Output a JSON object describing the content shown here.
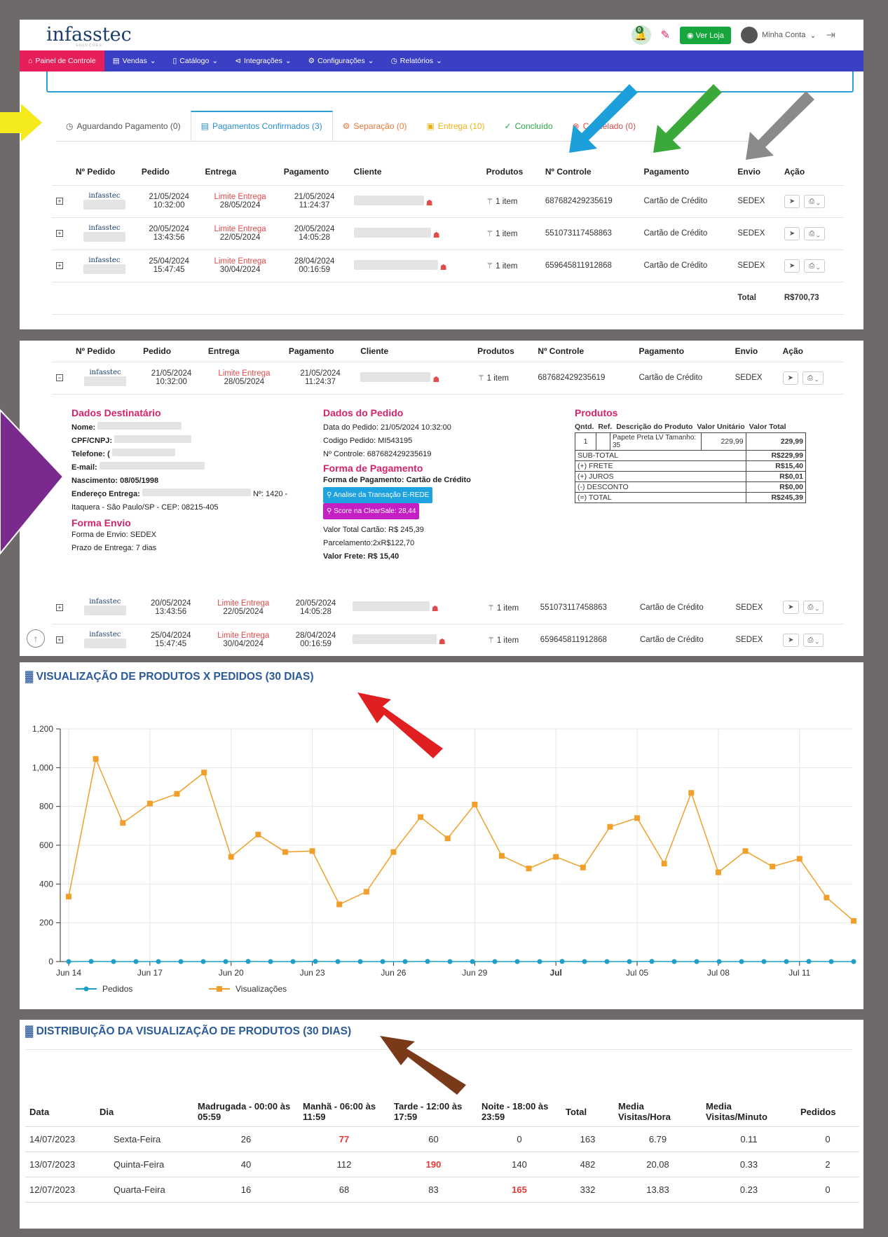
{
  "header": {
    "logo": "infasstec",
    "logo_tagline": "SOLUÇÕES",
    "notif_count": "0",
    "ver_loja": "Ver Loja",
    "minha_conta": "Minha Conta"
  },
  "nav": [
    "Painel de Controle",
    "Vendas",
    "Catálogo",
    "Integrações",
    "Configurações",
    "Relatórios"
  ],
  "tabs": [
    {
      "label": "Aguardando Pagamento (0)",
      "color": "#555"
    },
    {
      "label": "Pagamentos Confirmados (3)",
      "color": "#2a8fcc"
    },
    {
      "label": "Separação (0)",
      "color": "#e87a3a"
    },
    {
      "label": "Entrega (10)",
      "color": "#f0b21a"
    },
    {
      "label": "Concluído",
      "color": "#2aa84a"
    },
    {
      "label": "Cancelado (0)",
      "color": "#e14b4b"
    }
  ],
  "orders": {
    "headers": [
      "Nº Pedido",
      "Pedido",
      "Entrega",
      "Pagamento",
      "Cliente",
      "Produtos",
      "Nº Controle",
      "Pagamento",
      "Envio",
      "Ação"
    ],
    "rows": [
      {
        "pedido_date": "21/05/2024",
        "pedido_time": "10:32:00",
        "entrega_label": "Limite Entrega",
        "entrega_date": "28/05/2024",
        "pag_date": "21/05/2024",
        "pag_time": "11:24:37",
        "produtos": "1 item",
        "controle": "687682429235619",
        "pagamento": "Cartão de Crédito",
        "envio": "SEDEX"
      },
      {
        "pedido_date": "20/05/2024",
        "pedido_time": "13:43:56",
        "entrega_label": "Limite Entrega",
        "entrega_date": "22/05/2024",
        "pag_date": "20/05/2024",
        "pag_time": "14:05:28",
        "produtos": "1 item",
        "controle": "551073117458863",
        "pagamento": "Cartão de Crédito",
        "envio": "SEDEX"
      },
      {
        "pedido_date": "25/04/2024",
        "pedido_time": "15:47:45",
        "entrega_label": "Limite Entrega",
        "entrega_date": "30/04/2024",
        "pag_date": "28/04/2024",
        "pag_time": "00:16:59",
        "produtos": "1 item",
        "controle": "659645811912868",
        "pagamento": "Cartão de Crédito",
        "envio": "SEDEX"
      }
    ],
    "total_label": "Total",
    "total_value": "R$700,73"
  },
  "details": {
    "dest_title": "Dados Destinatário",
    "nome": "Nome:",
    "cpf": "CPF/CNPJ:",
    "telefone": "Telefone: (",
    "email": "E-mail:",
    "nascimento": "Nascimento: 08/05/1998",
    "endereco": "Endereço Entrega:",
    "numero": "Nº: 1420 -",
    "bairro": "Itaquera - São Paulo/SP - CEP: 08215-405",
    "envio_title": "Forma Envio",
    "forma_envio": "Forma de Envio: SEDEX",
    "prazo": "Prazo de Entrega: 7 dias",
    "pedido_title": "Dados do Pedido",
    "data_pedido": "Data do Pedido: 21/05/2024 10:32:00",
    "codigo": "Codigo Pedido: MI543195",
    "controle": "Nº Controle: 687682429235619",
    "pag_title": "Forma de Pagamento",
    "forma_pag": "Forma de Pagamento: Cartão de Crédito",
    "btn_rede": "Analise da Transação E-REDE",
    "btn_clear": "Score na ClearSale: 28,44",
    "valor_total": "Valor Total Cartão: R$ 245,39",
    "parcelamento": "Parcelamento:2xR$122,70",
    "frete": "Valor Frete: R$ 15,40",
    "prod_title": "Produtos",
    "prod_headers": [
      "Qntd.",
      "Ref.",
      "Descrição do Produto",
      "Valor Unitário",
      "Valor Total"
    ],
    "prod_row": {
      "qtd": "1",
      "desc": "Papete Preta LV Tamanho: 35",
      "unit": "229,99",
      "total": "229,99"
    },
    "summary": [
      [
        "SUB-TOTAL",
        "R$229,99"
      ],
      [
        "(+) FRETE",
        "R$15,40"
      ],
      [
        "(+) JUROS",
        "R$0,01"
      ],
      [
        "(-) DESCONTO",
        "R$0,00"
      ],
      [
        "(=) TOTAL",
        "R$245,39"
      ]
    ]
  },
  "chart_title": "VISUALIZAÇÃO DE PRODUTOS X PEDIDOS (30 DIAS)",
  "chart_data": {
    "type": "line",
    "title": "VISUALIZAÇÃO DE PRODUTOS X PEDIDOS (30 DIAS)",
    "x_tick_labels": [
      "Jun 14",
      "Jun 17",
      "Jun 20",
      "Jun 23",
      "Jun 26",
      "Jun 29",
      "Jul",
      "Jul 05",
      "Jul 08",
      "Jul 11"
    ],
    "ylim": [
      0,
      1200
    ],
    "y_ticks": [
      "0",
      "200",
      "400",
      "600",
      "800",
      "1,000",
      "1,200"
    ],
    "legend_position": "bottom-left",
    "series": [
      {
        "name": "Pedidos",
        "color": "#1ea0c8",
        "values": [
          0,
          1,
          0,
          0,
          0,
          0,
          0,
          0,
          1,
          0,
          0,
          1,
          0,
          0,
          0,
          0,
          1,
          0,
          0,
          0,
          0,
          0,
          1,
          0,
          0,
          0,
          1,
          0,
          0,
          0,
          0,
          0,
          0,
          1,
          0,
          0
        ]
      },
      {
        "name": "Visualizações",
        "color": "#f0a02a",
        "values": [
          335,
          1045,
          715,
          815,
          865,
          975,
          540,
          655,
          565,
          570,
          295,
          360,
          565,
          745,
          635,
          810,
          545,
          480,
          540,
          485,
          695,
          740,
          505,
          870,
          460,
          570,
          490,
          530,
          330,
          210
        ]
      }
    ]
  },
  "dist_title": "DISTRIBUIÇÃO DA VISUALIZAÇÃO DE PRODUTOS (30 DIAS)",
  "dist": {
    "headers": [
      "Data",
      "Dia",
      "Madrugada - 00:00 às 05:59",
      "Manhã - 06:00 às 11:59",
      "Tarde - 12:00 às 17:59",
      "Noite - 18:00 às 23:59",
      "Total",
      "Media Visitas/Hora",
      "Media Visitas/Minuto",
      "Pedidos"
    ],
    "rows": [
      [
        "14/07/2023",
        "Sexta-Feira",
        "26",
        "77",
        "60",
        "0",
        "163",
        "6.79",
        "0.11",
        "0"
      ],
      [
        "13/07/2023",
        "Quinta-Feira",
        "40",
        "112",
        "190",
        "140",
        "482",
        "20.08",
        "0.33",
        "2"
      ],
      [
        "12/07/2023",
        "Quarta-Feira",
        "16",
        "68",
        "83",
        "165",
        "332",
        "13.83",
        "0.23",
        "0"
      ]
    ],
    "highlight": [
      [
        3
      ],
      [
        4
      ],
      [
        5
      ]
    ]
  }
}
